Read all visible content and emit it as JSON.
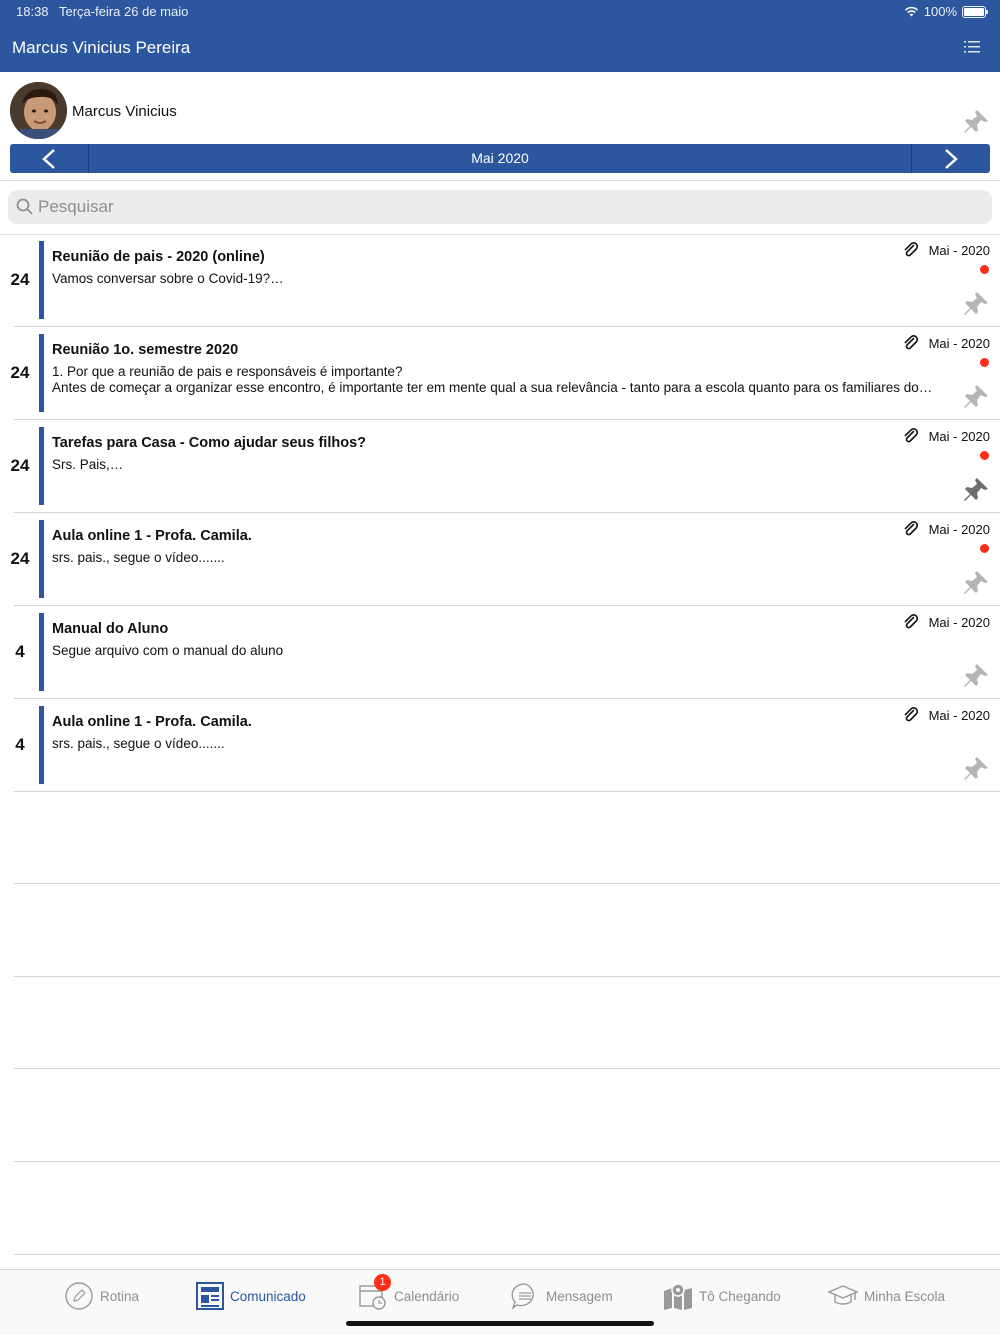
{
  "status_bar": {
    "time": "18:38",
    "date": "Terça-feira 26 de maio",
    "battery": "100%"
  },
  "header": {
    "title": "Marcus Vinicius Pereira",
    "menu_icon": "list-icon"
  },
  "student": {
    "name": "Marcus Vinicius",
    "pin_icon": "pin-icon"
  },
  "month_nav": {
    "label": "Mai 2020",
    "prev_icon": "chevron-left-icon",
    "next_icon": "chevron-right-icon"
  },
  "search": {
    "placeholder": "Pesquisar",
    "value": ""
  },
  "colors": {
    "primary": "#2c579e",
    "unread_dot": "#ff2d19",
    "pin_inactive": "#b5b5b5",
    "pin_active": "#6e6e6e"
  },
  "messages": [
    {
      "day": "24",
      "title": "Reunião de pais  - 2020 (online)",
      "lines": [
        "Vamos conversar sobre o Covid-19?…"
      ],
      "date": "Mai - 2020",
      "unread": true,
      "pinned": false
    },
    {
      "day": "24",
      "title": "Reunião 1o. semestre 2020",
      "lines": [
        "1. Por que a reunião de pais e responsáveis é importante?",
        "Antes de começar a organizar esse encontro, é importante ter em mente qual a sua relevância - tanto para a escola quanto para os familiares do…"
      ],
      "date": "Mai - 2020",
      "unread": true,
      "pinned": false
    },
    {
      "day": "24",
      "title": "Tarefas para Casa - Como ajudar seus filhos?",
      "lines": [
        "Srs. Pais,…"
      ],
      "date": "Mai - 2020",
      "unread": true,
      "pinned": true
    },
    {
      "day": "24",
      "title": "Aula online 1 - Profa. Camila.",
      "lines": [
        "srs. pais., segue o vídeo.......",
        ""
      ],
      "date": "Mai - 2020",
      "unread": true,
      "pinned": false
    },
    {
      "day": "4",
      "title": "Manual do Aluno",
      "lines": [
        "Segue arquivo com o manual do aluno"
      ],
      "date": "Mai - 2020",
      "unread": false,
      "pinned": false
    },
    {
      "day": "4",
      "title": "Aula online 1 - Profa. Camila.",
      "lines": [
        "srs. pais., segue o vídeo......."
      ],
      "date": "Mai - 2020",
      "unread": false,
      "pinned": false
    }
  ],
  "tabs": [
    {
      "label": "Rotina",
      "icon": "pencil-circle-icon",
      "active": false
    },
    {
      "label": "Comunicado",
      "icon": "newspaper-icon",
      "active": true
    },
    {
      "label": "Calendário",
      "icon": "calendar-clock-icon",
      "active": false,
      "badge": "1"
    },
    {
      "label": "Mensagem",
      "icon": "chat-bubble-icon",
      "active": false
    },
    {
      "label": "Tô Chegando",
      "icon": "map-pin-icon",
      "active": false
    },
    {
      "label": "Minha Escola",
      "icon": "graduation-cap-icon",
      "active": false
    }
  ]
}
